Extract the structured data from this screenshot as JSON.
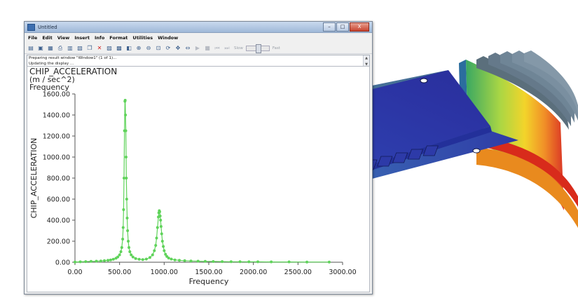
{
  "window": {
    "title": "Untitled",
    "minimize": "–",
    "maximize": "□",
    "close": "X",
    "menu": [
      "File",
      "Edit",
      "View",
      "Insert",
      "Info",
      "Format",
      "Utilities",
      "Window"
    ],
    "toolbar_slow": "Slow",
    "toolbar_fast": "Fast",
    "messages": [
      "Preparing result window \"Window1\" (1 of 1)...",
      "Updating the display ..."
    ]
  },
  "colors": {
    "series": "#5fd35a",
    "axis": "#555555",
    "text": "#222222"
  },
  "chart_data": {
    "type": "scatter",
    "title": "CHIP_ACCELERATION",
    "subtitle": "(m / sec^2)",
    "subtitle2": "Frequency",
    "xlabel": "Frequency",
    "ylabel": "CHIP_ACCELERATION",
    "xlim": [
      0,
      3000
    ],
    "ylim": [
      0,
      1600
    ],
    "x_ticks": [
      "0.00",
      "500.00",
      "1000.00",
      "1500.00",
      "2000.00",
      "2500.00",
      "3000.00"
    ],
    "y_ticks": [
      "0.00",
      "200.00",
      "400.00",
      "600.00",
      "800.00",
      "1000.00",
      "1200.00",
      "1400.00",
      "1600.00"
    ],
    "grid": false,
    "series": [
      {
        "x": [
          0,
          60,
          120,
          180,
          240,
          290,
          330,
          370,
          400,
          430,
          460,
          480,
          500,
          515,
          525,
          535,
          540,
          545,
          550,
          555,
          560,
          563,
          566,
          570,
          573,
          576,
          580,
          585,
          590,
          597,
          605,
          615,
          630,
          650,
          680,
          720,
          760,
          800,
          840,
          870,
          890,
          905,
          915,
          925,
          935,
          940,
          945,
          950,
          955,
          960,
          965,
          972,
          980,
          990,
          1000,
          1015,
          1030,
          1050,
          1080,
          1120,
          1170,
          1230,
          1300,
          1380,
          1460,
          1550,
          1650,
          1750,
          1850,
          1950,
          2050,
          2200,
          2400,
          2600,
          2850
        ],
        "y": [
          2,
          4,
          6,
          8,
          10,
          12,
          15,
          18,
          22,
          28,
          38,
          50,
          70,
          100,
          140,
          220,
          330,
          500,
          800,
          1250,
          1530,
          1540,
          1400,
          1250,
          1000,
          800,
          600,
          420,
          300,
          200,
          140,
          100,
          70,
          50,
          35,
          28,
          25,
          30,
          45,
          70,
          110,
          160,
          230,
          330,
          430,
          470,
          490,
          480,
          440,
          400,
          340,
          270,
          200,
          150,
          110,
          75,
          55,
          40,
          30,
          22,
          18,
          15,
          12,
          10,
          8,
          7,
          6,
          5,
          5,
          4,
          4,
          3,
          3,
          2,
          2
        ]
      }
    ]
  }
}
